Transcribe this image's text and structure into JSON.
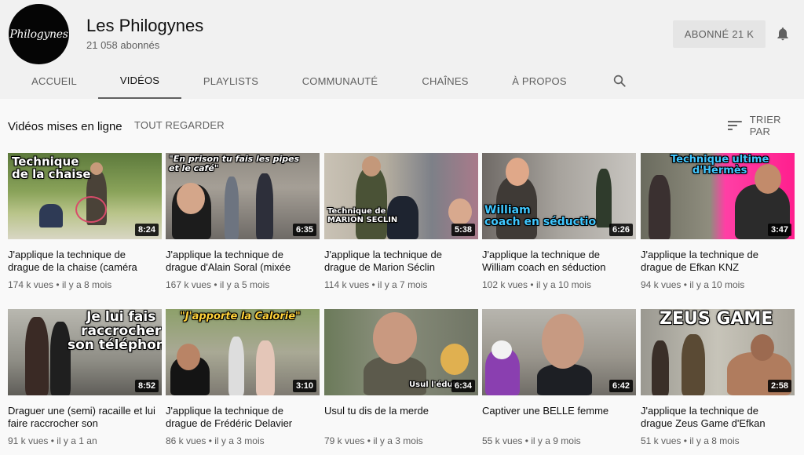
{
  "channel": {
    "avatar_text": "Philogynes",
    "name": "Les Philogynes",
    "subscribers": "21 058 abonnés",
    "subscribe_button": "ABONNÉ  21 K",
    "bell_icon": "bell-icon"
  },
  "tabs": [
    {
      "label": "ACCUEIL",
      "active": false
    },
    {
      "label": "VIDÉOS",
      "active": true
    },
    {
      "label": "PLAYLISTS",
      "active": false
    },
    {
      "label": "COMMUNAUTÉ",
      "active": false
    },
    {
      "label": "CHAÎNES",
      "active": false
    },
    {
      "label": "À PROPOS",
      "active": false
    }
  ],
  "search_icon": "search-icon",
  "section": {
    "title": "Vidéos mises en ligne",
    "play_all": "TOUT REGARDER",
    "sort_label": "TRIER PAR",
    "sort_icon": "sort-icon"
  },
  "videos": [
    {
      "thumb_text": "Technique\nde la chaise",
      "duration": "8:24",
      "title": "J'applique la technique de drague de la chaise (caméra",
      "views": "174 k vues",
      "age": "il y a 8 mois"
    },
    {
      "thumb_text": "\"En prison tu fais les pipes\net le café\"",
      "duration": "6:35",
      "title": "J'applique la technique de drague d'Alain Soral (mixée",
      "views": "167 k vues",
      "age": "il y a 5 mois"
    },
    {
      "thumb_text": "Technique de\nMARION SECLIN",
      "duration": "5:38",
      "title": "J'applique la technique de drague de Marion Séclin",
      "views": "114 k vues",
      "age": "il y a 7 mois"
    },
    {
      "thumb_text": "William\ncoach en séductio",
      "duration": "6:26",
      "title": "J'applique la technique de William coach en séduction",
      "views": "102 k vues",
      "age": "il y a 10 mois"
    },
    {
      "thumb_text": "Technique ultime\nd'Hermès",
      "duration": "3:47",
      "title": "J'applique la technique de drague de Efkan KNZ",
      "views": "94 k vues",
      "age": "il y a 10 mois"
    },
    {
      "thumb_text": "Je lui fais\nraccrocher\nson téléphone",
      "duration": "8:52",
      "title": "Draguer une (semi) racaille et lui faire raccrocher son",
      "views": "91 k vues",
      "age": "il y a 1 an"
    },
    {
      "thumb_text": "\"J'apporte la Calorie\"",
      "duration": "3:10",
      "title": "J'applique la technique de drague de Frédéric Delavier",
      "views": "86 k vues",
      "age": "il y a 3 mois"
    },
    {
      "thumb_text": "Usul l'édut",
      "duration": "6:34",
      "title": "Usul tu dis de la merde",
      "views": "79 k vues",
      "age": "il y a 3 mois"
    },
    {
      "thumb_text": "",
      "duration": "6:42",
      "title": "Captiver une BELLE femme",
      "views": "55 k vues",
      "age": "il y a 9 mois"
    },
    {
      "thumb_text": "ZEUS GAME",
      "duration": "2:58",
      "title": "J'applique la technique de drague Zeus Game d'Efkan",
      "views": "51 k vues",
      "age": "il y a 8 mois"
    }
  ],
  "meta_separator": "•"
}
